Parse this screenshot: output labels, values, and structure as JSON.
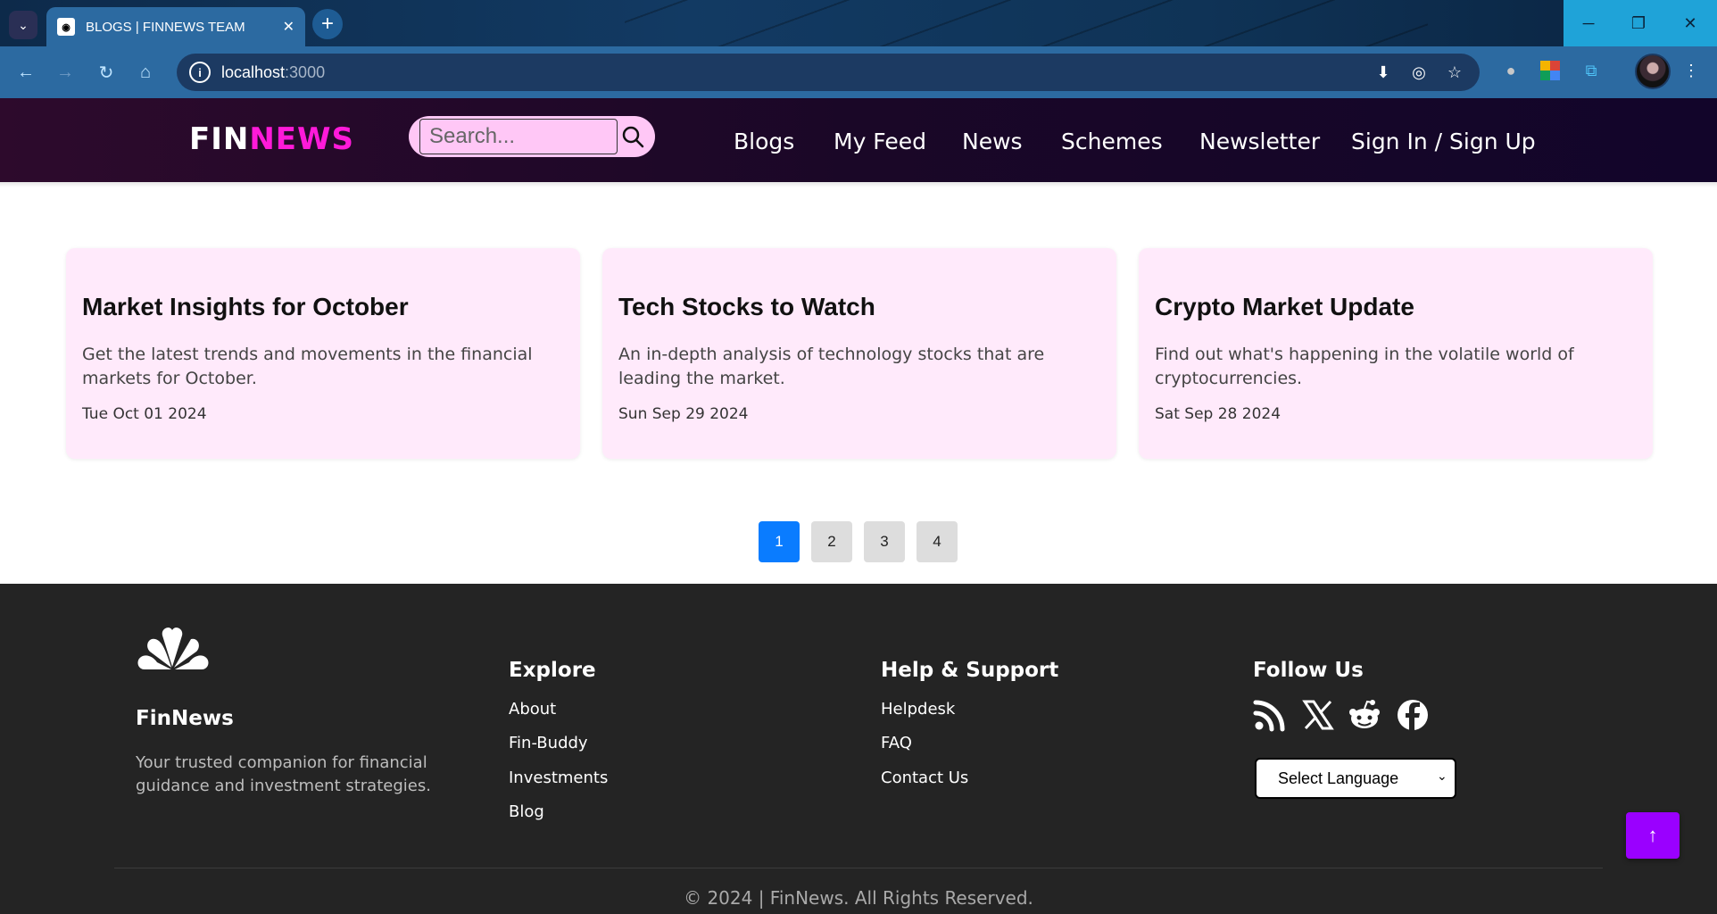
{
  "browser": {
    "tab_title": "BLOGS | FINNEWS TEAM",
    "tab_close": "✕",
    "new_tab": "+",
    "url_host": "localhost",
    "url_port": ":3000"
  },
  "header": {
    "logo_fin": "FIN",
    "logo_news": "NEWS",
    "search_placeholder": "Search...",
    "nav": [
      "Blogs",
      "My Feed",
      "News",
      "Schemes",
      "Newsletter",
      "Sign In / Sign Up"
    ]
  },
  "cards": [
    {
      "title": "Market Insights for October",
      "description": "Get the latest trends and movements in the financial markets for October.",
      "date": "Tue Oct 01 2024"
    },
    {
      "title": "Tech Stocks to Watch",
      "description": "An in-depth analysis of technology stocks that are leading the market.",
      "date": "Sun Sep 29 2024"
    },
    {
      "title": "Crypto Market Update",
      "description": "Find out what's happening in the volatile world of cryptocurrencies.",
      "date": "Sat Sep 28 2024"
    }
  ],
  "pagination": {
    "pages": [
      "1",
      "2",
      "3",
      "4"
    ],
    "active": "1"
  },
  "footer": {
    "brand_name": "FinNews",
    "brand_desc": "Your trusted companion for financial guidance and investment strategies.",
    "explore_heading": "Explore",
    "explore_links": [
      "About",
      "Fin-Buddy",
      "Investments",
      "Blog"
    ],
    "help_heading": "Help & Support",
    "help_links": [
      "Helpdesk",
      "FAQ",
      "Contact Us"
    ],
    "follow_heading": "Follow Us",
    "social_icons": [
      "rss-icon",
      "x-icon",
      "reddit-icon",
      "facebook-icon"
    ],
    "language_select": "Select Language",
    "copyright": "© 2024 | FinNews. All Rights Reserved.",
    "to_top": "↑"
  },
  "colors": {
    "accent_pink": "#ff1ad9",
    "card_bg": "#ffeafb",
    "active_page": "#0a7cff",
    "to_top_button": "#9a00ff",
    "footer_bg": "#242424"
  }
}
